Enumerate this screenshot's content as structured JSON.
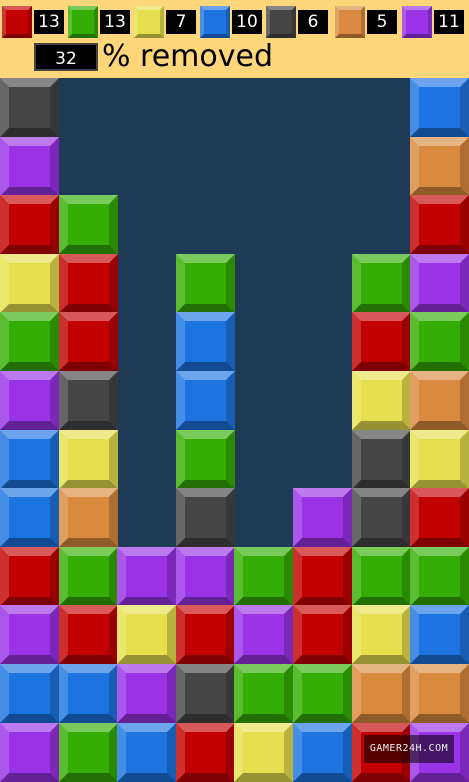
{
  "hud": {
    "counters": [
      {
        "color": "red",
        "value": "13",
        "hex": "#c20000"
      },
      {
        "color": "green",
        "value": "13",
        "hex": "#34ad04"
      },
      {
        "color": "yellow",
        "value": "7",
        "hex": "#e6e04e"
      },
      {
        "color": "blue",
        "value": "10",
        "hex": "#1d74e0"
      },
      {
        "color": "gray",
        "value": "6",
        "hex": "#454545"
      },
      {
        "color": "orange",
        "value": "5",
        "hex": "#d98a3e"
      },
      {
        "color": "purple",
        "value": "11",
        "hex": "#9a32e6"
      }
    ],
    "percent_value": "32",
    "percent_label": "% removed"
  },
  "board": {
    "columns": 8,
    "rows": 12,
    "grid": [
      [
        "G",
        "",
        "",
        "",
        "",
        "",
        "",
        "B"
      ],
      [
        "P",
        "",
        "",
        "",
        "",
        "",
        "",
        "O"
      ],
      [
        "R",
        "Gn",
        "",
        "",
        "",
        "",
        "",
        "R"
      ],
      [
        "Y",
        "R",
        "",
        "Gn",
        "",
        "",
        "Gn",
        "P"
      ],
      [
        "Gn",
        "R",
        "",
        "B",
        "",
        "",
        "R",
        "Gn"
      ],
      [
        "P",
        "G",
        "",
        "B",
        "",
        "",
        "Y",
        "O"
      ],
      [
        "B",
        "Y",
        "",
        "Gn",
        "",
        "",
        "G",
        "Y"
      ],
      [
        "B",
        "O",
        "",
        "G",
        "",
        "P",
        "G",
        "R"
      ],
      [
        "R",
        "Gn",
        "P",
        "P",
        "Gn",
        "R",
        "Gn",
        "Gn"
      ],
      [
        "P",
        "R",
        "Y",
        "R",
        "P",
        "R",
        "Y",
        "B"
      ],
      [
        "B",
        "B",
        "P",
        "G",
        "Gn",
        "Gn",
        "O",
        "O"
      ],
      [
        "P",
        "Gn",
        "B",
        "R",
        "Y",
        "B",
        "R",
        "P"
      ]
    ]
  },
  "watermark": "GAMER24H.COM",
  "palette": {
    "R": "#c20000",
    "Gn": "#34ad04",
    "Y": "#e6e04e",
    "B": "#1d74e0",
    "G": "#454545",
    "O": "#d98a3e",
    "P": "#9a32e6"
  }
}
